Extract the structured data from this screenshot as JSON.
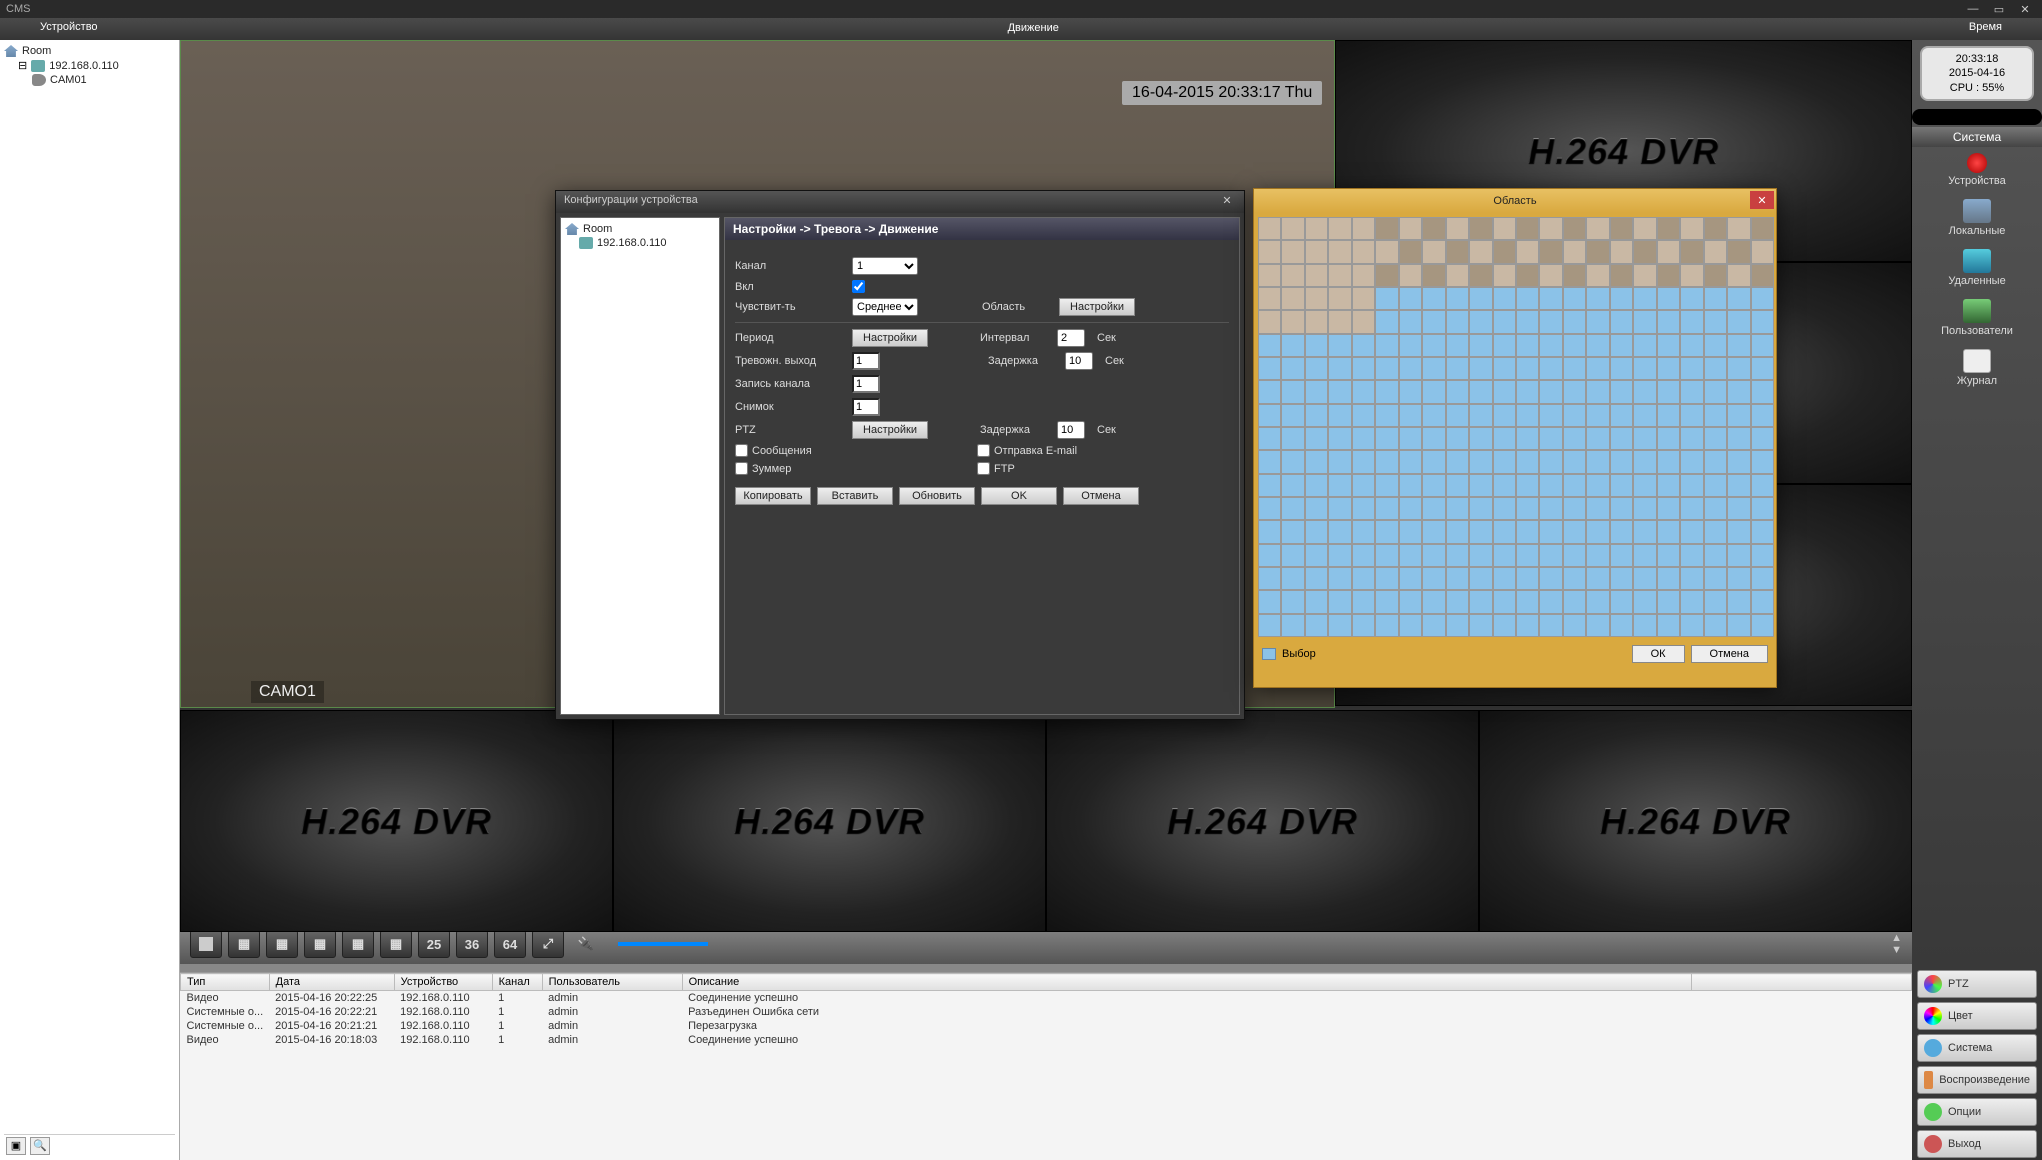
{
  "app_title": "CMS",
  "menubar": {
    "device": "Устройство",
    "motion": "Движение",
    "time": "Время"
  },
  "tree": {
    "root": "Room",
    "ip": "192.168.0.110",
    "cam": "CAM01"
  },
  "clock": {
    "time": "20:33:18",
    "date": "2015-04-16",
    "cpu": "CPU : 55%"
  },
  "sidebar_header": "Система",
  "sidebar": {
    "devices": "Устройства",
    "local": "Локальные",
    "remote": "Удаленные",
    "users": "Пользователи",
    "journal": "Журнал"
  },
  "video": {
    "timestamp": "16-04-2015 20:33:17 Thu",
    "cam_label": "CAMO1",
    "dvr_text": "H.264 DVR"
  },
  "vtoolbar": {
    "b25": "25",
    "b36": "36",
    "b64": "64"
  },
  "log": {
    "headers": {
      "type": "Тип",
      "date": "Дата",
      "device": "Устройство",
      "channel": "Канал",
      "user": "Пользователь",
      "desc": "Описание"
    },
    "rows": [
      {
        "type": "Видео",
        "date": "2015-04-16 20:22:25",
        "device": "192.168.0.110",
        "channel": "1",
        "user": "admin",
        "desc": "Соединение успешно"
      },
      {
        "type": "Системные о...",
        "date": "2015-04-16 20:22:21",
        "device": "192.168.0.110",
        "channel": "1",
        "user": "admin",
        "desc": "Разъединен Ошибка сети"
      },
      {
        "type": "Системные о...",
        "date": "2015-04-16 20:21:21",
        "device": "192.168.0.110",
        "channel": "1",
        "user": "admin",
        "desc": "Перезагрузка"
      },
      {
        "type": "Видео",
        "date": "2015-04-16 20:18:03",
        "device": "192.168.0.110",
        "channel": "1",
        "user": "admin",
        "desc": "Соединение успешно"
      }
    ]
  },
  "rb": {
    "ptz": "PTZ",
    "color": "Цвет",
    "system": "Система",
    "playback": "Воспроизведение",
    "options": "Опции",
    "exit": "Выход"
  },
  "dlg1": {
    "title": "Конфигурации устройства",
    "crumb": "Настройки -> Тревога -> Движение",
    "tree_root": "Room",
    "tree_ip": "192.168.0.110",
    "labels": {
      "channel": "Канал",
      "enable": "Вкл",
      "sensitivity": "Чувствит-ть",
      "region": "Область",
      "settings_btn": "Настройки",
      "period": "Период",
      "interval": "Интервал",
      "sec": "Сек",
      "alarm_out": "Тревожн. выход",
      "delay": "Задержка",
      "record_ch": "Запись канала",
      "snapshot": "Снимок",
      "ptz": "PTZ",
      "msg": "Сообщения",
      "buzzer": "Зуммер",
      "email": "Отправка E-mail",
      "ftp": "FTP",
      "copy": "Копировать",
      "paste": "Вставить",
      "refresh": "Обновить",
      "ok": "OK",
      "cancel": "Отмена"
    },
    "vals": {
      "channel": "1",
      "sensitivity": "Среднее",
      "interval": "2",
      "delay": "10",
      "alarm_out": "1",
      "record_ch": "1",
      "snapshot": "1",
      "ptz_delay": "10"
    }
  },
  "dlg2": {
    "title": "Область",
    "legend": "Выбор",
    "ok": "ОК",
    "cancel": "Отмена"
  }
}
